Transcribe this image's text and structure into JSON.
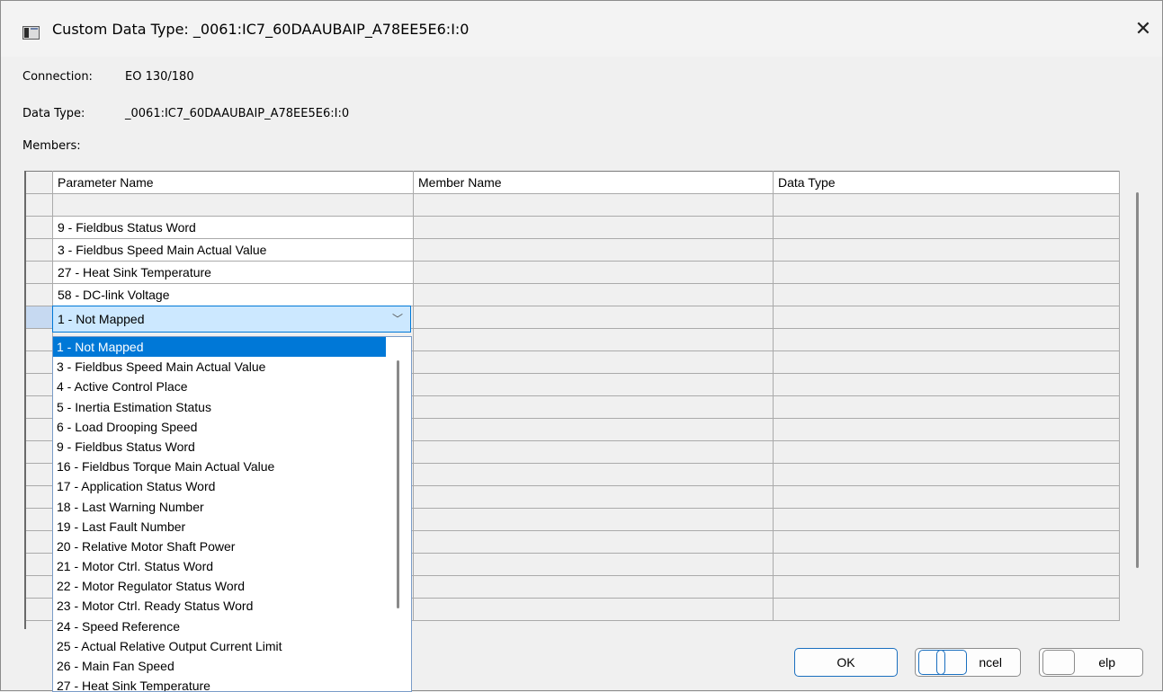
{
  "window": {
    "title": "Custom Data Type:  _0061:IC7_60DAAUBAIP_A78EE5E6:I:0",
    "close_glyph": "✕"
  },
  "info": {
    "connection_label": "Connection:",
    "connection_value": "EO 130/180",
    "data_type_label": "Data Type:",
    "data_type_value": "_0061:IC7_60DAAUBAIP_A78EE5E6:I:0",
    "members_label": "Members:"
  },
  "grid": {
    "headers": [
      "Parameter Name",
      "Member Name",
      "Data Type"
    ],
    "rows": [
      "",
      "9 - Fieldbus Status Word",
      "3 - Fieldbus Speed Main Actual Value",
      "27 - Heat Sink Temperature",
      "58 - DC-link Voltage"
    ]
  },
  "combo": {
    "value": "1 - Not Mapped",
    "arrow_glyph": "﹀"
  },
  "dropdown": {
    "options": [
      "1 - Not Mapped",
      "3 - Fieldbus Speed Main Actual Value",
      "4 - Active Control Place",
      "5 - Inertia Estimation Status",
      "6 - Load Drooping Speed",
      "9 - Fieldbus Status Word",
      "16 - Fieldbus Torque Main Actual Value",
      "17 - Application Status Word",
      "18 - Last Warning Number",
      "19 - Last Fault Number",
      "20 - Relative Motor Shaft Power",
      "21 - Motor Ctrl. Status Word",
      "22 - Motor Regulator Status Word",
      "23 - Motor Ctrl. Ready Status Word",
      "24 - Speed Reference",
      "25 - Actual Relative Output Current Limit",
      "26 - Main Fan Speed",
      "27 - Heat Sink Temperature"
    ]
  },
  "buttons": {
    "ok": "OK",
    "cancel": "ncel",
    "help": "elp"
  }
}
